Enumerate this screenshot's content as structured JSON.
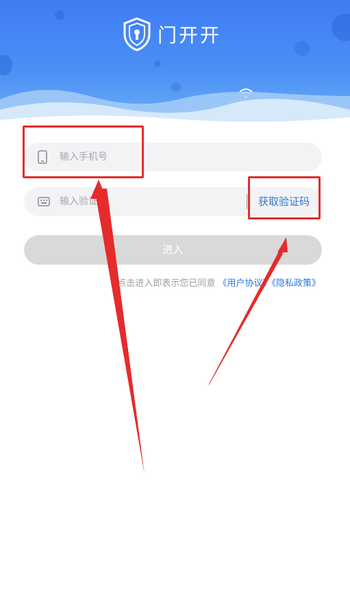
{
  "header": {
    "app_name": "门开开",
    "logo_icon": "shield-lock-icon",
    "wave_icon": "wifi-icon",
    "gradient_top": "#3f7df3",
    "gradient_bottom": "#6eb0f7"
  },
  "form": {
    "phone": {
      "icon": "phone-icon",
      "placeholder": "输入手机号"
    },
    "code": {
      "icon": "keyboard-icon",
      "placeholder": "输入验证码",
      "get_code_label": "获取验证码"
    },
    "enter_label": "进入",
    "agreement": {
      "prefix": "点击进入即表示您已同意",
      "user_agreement": "《用户协议》",
      "privacy_policy": "《隐私政策》"
    }
  },
  "colors": {
    "accent": "#2b78d9",
    "disabled_button": "#d9d9d9",
    "annotation": "#e52b2b"
  }
}
